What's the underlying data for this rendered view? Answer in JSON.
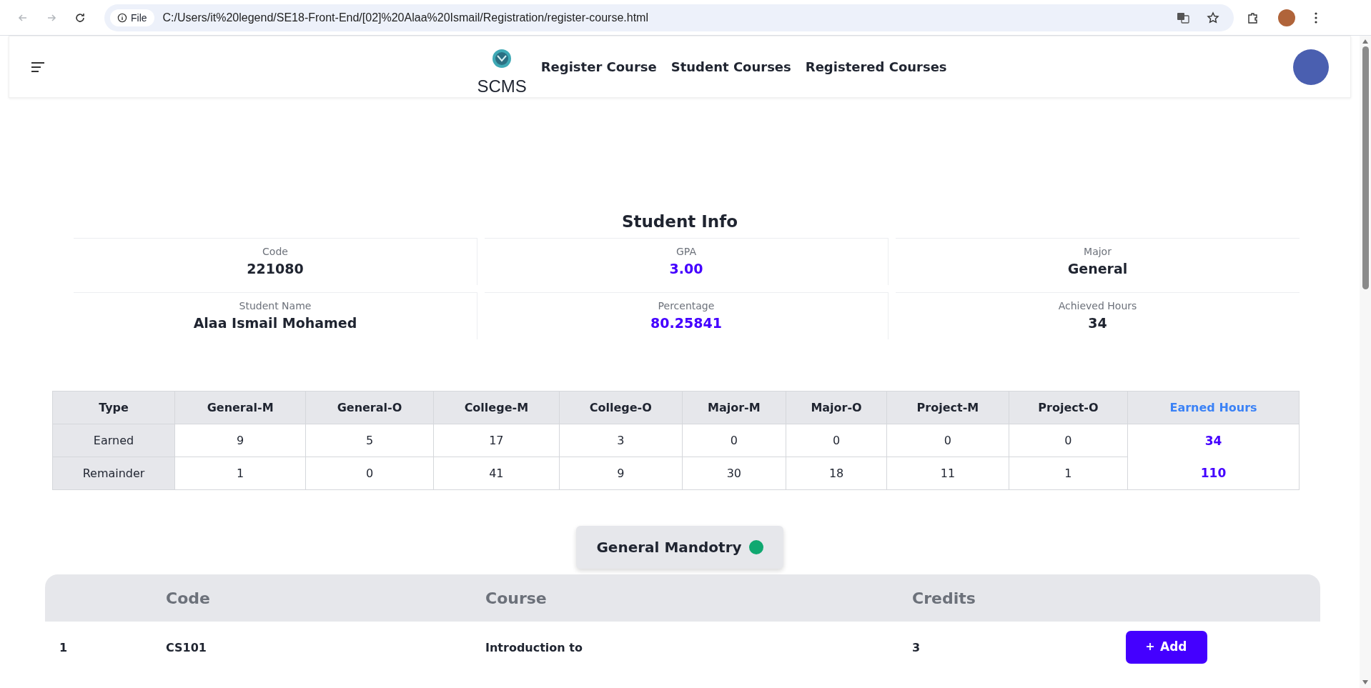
{
  "browser": {
    "file_chip": "File",
    "url": "C:/Users/it%20legend/SE18-Front-End/[02]%20Alaa%20Ismail/Registration/register-course.html"
  },
  "header": {
    "logo_text": "SCMS",
    "nav": [
      {
        "label": "Register Course"
      },
      {
        "label": "Student Courses"
      },
      {
        "label": "Registered Courses"
      }
    ]
  },
  "student_info": {
    "title": "Student Info",
    "fields": [
      {
        "label": "Code",
        "value": "221080",
        "highlight": false
      },
      {
        "label": "GPA",
        "value": "3.00",
        "highlight": true
      },
      {
        "label": "Major",
        "value": "General",
        "highlight": false
      },
      {
        "label": "Student Name",
        "value": "Alaa Ismail Mohamed",
        "highlight": false
      },
      {
        "label": "Percentage",
        "value": "80.25841",
        "highlight": true
      },
      {
        "label": "Achieved Hours",
        "value": "34",
        "highlight": false
      }
    ]
  },
  "hours_table": {
    "columns": [
      "Type",
      "General-M",
      "General-O",
      "College-M",
      "College-O",
      "Major-M",
      "Major-O",
      "Project-M",
      "Project-O",
      "Earned Hours"
    ],
    "rows": [
      {
        "type": "Earned",
        "values": [
          "9",
          "5",
          "17",
          "3",
          "0",
          "0",
          "0",
          "0"
        ],
        "total": "34"
      },
      {
        "type": "Remainder",
        "values": [
          "1",
          "0",
          "41",
          "9",
          "30",
          "18",
          "11",
          "1"
        ],
        "total": "110"
      }
    ]
  },
  "category": {
    "label": "General Mandotry"
  },
  "courses": {
    "columns": [
      "Code",
      "Course",
      "Credits"
    ],
    "rows": [
      {
        "index": "1",
        "code": "CS101",
        "course": "Introduction to",
        "credits": "3",
        "action": "Add"
      }
    ]
  }
}
